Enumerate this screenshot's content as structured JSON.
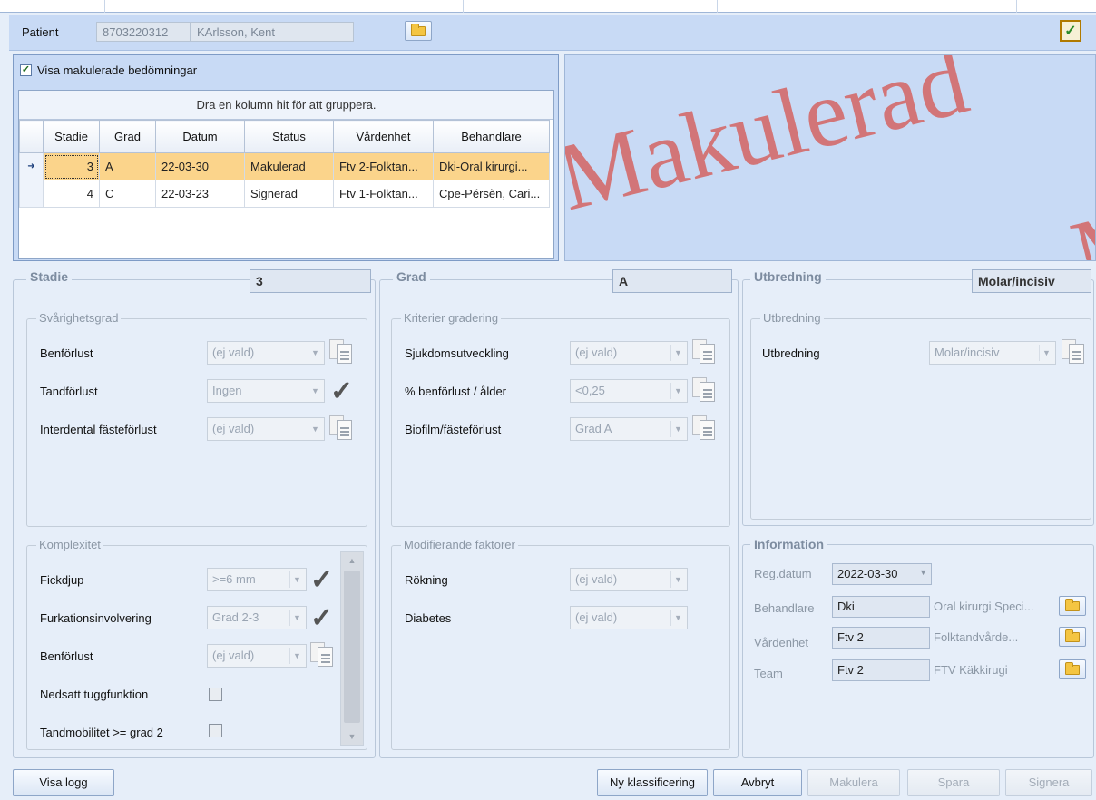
{
  "patient": {
    "label": "Patient",
    "id": "8703220312",
    "name": "KArlsson, Kent"
  },
  "grid": {
    "show_voided_label": "Visa makulerade bedömningar",
    "show_voided_checked": true,
    "group_hint": "Dra en kolumn hit för att gruppera.",
    "columns": [
      "Stadie",
      "Grad",
      "Datum",
      "Status",
      "Vårdenhet",
      "Behandlare"
    ],
    "rows": [
      {
        "stadie": "3",
        "grad": "A",
        "datum": "22-03-30",
        "status": "Makulerad",
        "vardenhet": "Ftv 2-Folktan...",
        "behandlare": "Dki-Oral kirurgi..."
      },
      {
        "stadie": "4",
        "grad": "C",
        "datum": "22-03-23",
        "status": "Signerad",
        "vardenhet": "Ftv 1-Folktan...",
        "behandlare": "Cpe-Pérsèn, Cari..."
      }
    ]
  },
  "preview": {
    "watermark": "Makulerad",
    "watermark_partial": "M"
  },
  "stadie": {
    "title": "Stadie",
    "value": "3",
    "svarighet": {
      "title": "Svårighetsgrad",
      "rows": [
        {
          "label": "Benförlust",
          "value": "(ej vald)",
          "icon": "document-icon"
        },
        {
          "label": "Tandförlust",
          "value": "Ingen",
          "icon": "checkmark-icon"
        },
        {
          "label": "Interdental fästeförlust",
          "value": "(ej vald)",
          "icon": "document-icon"
        }
      ]
    },
    "komplexitet": {
      "title": "Komplexitet",
      "rows": [
        {
          "label": "Fickdjup",
          "value": ">=6 mm",
          "icon": "checkmark-icon"
        },
        {
          "label": "Furkationsinvolvering",
          "value": "Grad 2-3",
          "icon": "checkmark-icon"
        },
        {
          "label": "Benförlust",
          "value": "(ej vald)",
          "icon": "document-icon"
        }
      ],
      "checks": [
        {
          "label": "Nedsatt tuggfunktion",
          "checked": false
        },
        {
          "label": "Tandmobilitet >= grad 2",
          "checked": false
        }
      ]
    }
  },
  "grad": {
    "title": "Grad",
    "value": "A",
    "kriterier": {
      "title": "Kriterier gradering",
      "rows": [
        {
          "label": "Sjukdomsutveckling",
          "value": "(ej vald)",
          "icon": "document-icon"
        },
        {
          "label": "% benförlust / ålder",
          "value": "<0,25",
          "icon": "document-icon"
        },
        {
          "label": "Biofilm/fästeförlust",
          "value": "Grad A",
          "icon": "document-icon"
        }
      ]
    },
    "modifierande": {
      "title": "Modifierande faktorer",
      "rows": [
        {
          "label": "Rökning",
          "value": "(ej vald)"
        },
        {
          "label": "Diabetes",
          "value": "(ej vald)"
        }
      ]
    }
  },
  "utbredning": {
    "title": "Utbredning",
    "value": "Molar/incisiv",
    "group_title": "Utbredning",
    "row_label": "Utbredning",
    "row_value": "Molar/incisiv"
  },
  "information": {
    "title": "Information",
    "regdatum_label": "Reg.datum",
    "regdatum_value": "2022-03-30",
    "behandlare_label": "Behandlare",
    "behandlare_code": "Dki",
    "behandlare_text": "Oral kirurgi Speci...",
    "vardenhet_label": "Vårdenhet",
    "vardenhet_code": "Ftv 2",
    "vardenhet_text": "Folktandvårde...",
    "team_label": "Team",
    "team_code": "Ftv 2",
    "team_text": "FTV Käkkirugi"
  },
  "footer": {
    "visa_logg": "Visa logg",
    "ny_klassificering": "Ny klassificering",
    "avbryt": "Avbryt",
    "makulera": "Makulera",
    "spara": "Spara",
    "signera": "Signera"
  }
}
